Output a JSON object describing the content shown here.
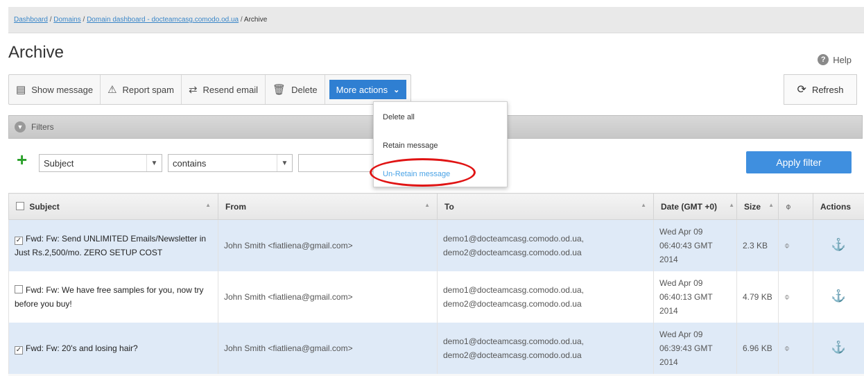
{
  "breadcrumb": {
    "items": [
      "Dashboard",
      "Domains",
      "Domain dashboard - docteamcasg.comodo.od.ua"
    ],
    "separator": " / ",
    "current": "Archive"
  },
  "page": {
    "title": "Archive",
    "help_label": "Help"
  },
  "toolbar": {
    "show_message": "Show message",
    "report_spam": "Report spam",
    "resend_email": "Resend email",
    "delete": "Delete",
    "more_actions": "More actions",
    "refresh": "Refresh"
  },
  "more_actions_menu": {
    "items": [
      "Delete all",
      "Retain message",
      "Un-Retain message"
    ],
    "highlighted": "Un-Retain message"
  },
  "filters": {
    "label": "Filters",
    "field": "Subject",
    "operator": "contains",
    "value": "",
    "apply_label": "Apply filter"
  },
  "table": {
    "columns": [
      "Subject",
      "From",
      "To",
      "Date (GMT +0)",
      "Size",
      "",
      "Actions"
    ],
    "rows": [
      {
        "checked": true,
        "subject": "Fwd: Fw: Send UNLIMITED Emails/Newsletter in Just Rs.2,500/mo. ZERO SETUP COST",
        "from": "John Smith <fiatliena@gmail.com>",
        "to": "demo1@docteamcasg.comodo.od.ua, demo2@docteamcasg.comodo.od.ua",
        "date": "Wed Apr 09 06:40:43 GMT 2014",
        "size": "2.3 KB"
      },
      {
        "checked": false,
        "subject": "Fwd: Fw: We have free samples for you, now try before you buy!",
        "from": "John Smith <fiatliena@gmail.com>",
        "to": "demo1@docteamcasg.comodo.od.ua, demo2@docteamcasg.comodo.od.ua",
        "date": "Wed Apr 09 06:40:13 GMT 2014",
        "size": "4.79 KB"
      },
      {
        "checked": true,
        "subject": "Fwd: Fw: 20's and losing hair?",
        "from": "John Smith <fiatliena@gmail.com>",
        "to": "demo1@docteamcasg.comodo.od.ua, demo2@docteamcasg.comodo.od.ua",
        "date": "Wed Apr 09 06:39:43 GMT 2014",
        "size": "6.96 KB"
      }
    ]
  },
  "colors": {
    "accent": "#2f7fd2",
    "selected_row": "#dfeaf7",
    "highlight_oval": "#e01414",
    "add_icon": "#2aa02a"
  }
}
